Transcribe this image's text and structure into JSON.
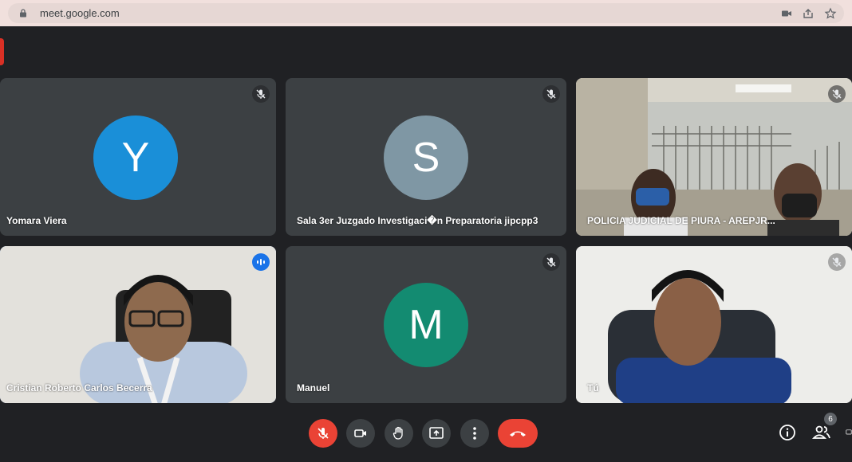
{
  "browser": {
    "url": "meet.google.com"
  },
  "participants": [
    {
      "name": "Yomara Viera",
      "initial": "Y",
      "avatar_color": "#1a8fd8",
      "muted": true
    },
    {
      "name": "Sala 3er Juzgado Investigaci�n Preparatoria jipcpp3",
      "initial": "S",
      "avatar_color": "#7f97a4",
      "muted": true
    },
    {
      "name": "POLICIA JUDICIAL DE PIURA - AREPJR...",
      "muted": true,
      "video": true
    },
    {
      "name": "Cristian Roberto Carlos Becerra",
      "speaking": true,
      "video": true
    },
    {
      "name": "Manuel",
      "initial": "M",
      "avatar_color": "#138b71",
      "muted": true
    },
    {
      "name": "Tú",
      "muted": true,
      "video": true
    }
  ],
  "controls": {
    "people_count": "6"
  },
  "colors": {
    "background": "#202124",
    "tile": "#3c4043",
    "end_call": "#ea4335",
    "active_outline": "#8ab4f8"
  }
}
